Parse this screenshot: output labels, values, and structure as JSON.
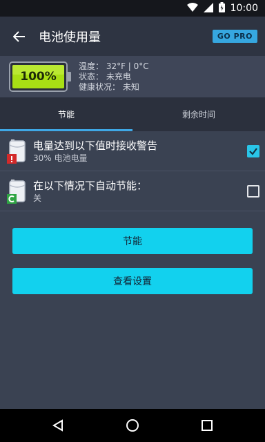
{
  "status": {
    "time": "10:00"
  },
  "app_bar": {
    "title": "电池使用量",
    "gopro": "GO PRO"
  },
  "battery": {
    "percent_label": "100%",
    "level": 1.0,
    "temperature": "温度： 32°F | 0°C",
    "state": "状态： 未充电",
    "health": "健康状况： 未知"
  },
  "tabs": [
    {
      "label": "节能",
      "active": true
    },
    {
      "label": "剩余时间",
      "active": false
    }
  ],
  "settings": [
    {
      "title": "电量达到以下值时接收警告",
      "subtitle": "30% 电池电量",
      "checked": true,
      "icon": "battery-alert-icon"
    },
    {
      "title": "在以下情况下自动节能：",
      "subtitle": "关",
      "checked": false,
      "icon": "battery-saver-icon"
    }
  ],
  "buttons": {
    "save": "节能",
    "settings": "查看设置"
  },
  "colors": {
    "accent": "#12d1ee",
    "tab_indicator": "#3fa8e6",
    "battery_green": "#a8df14"
  }
}
